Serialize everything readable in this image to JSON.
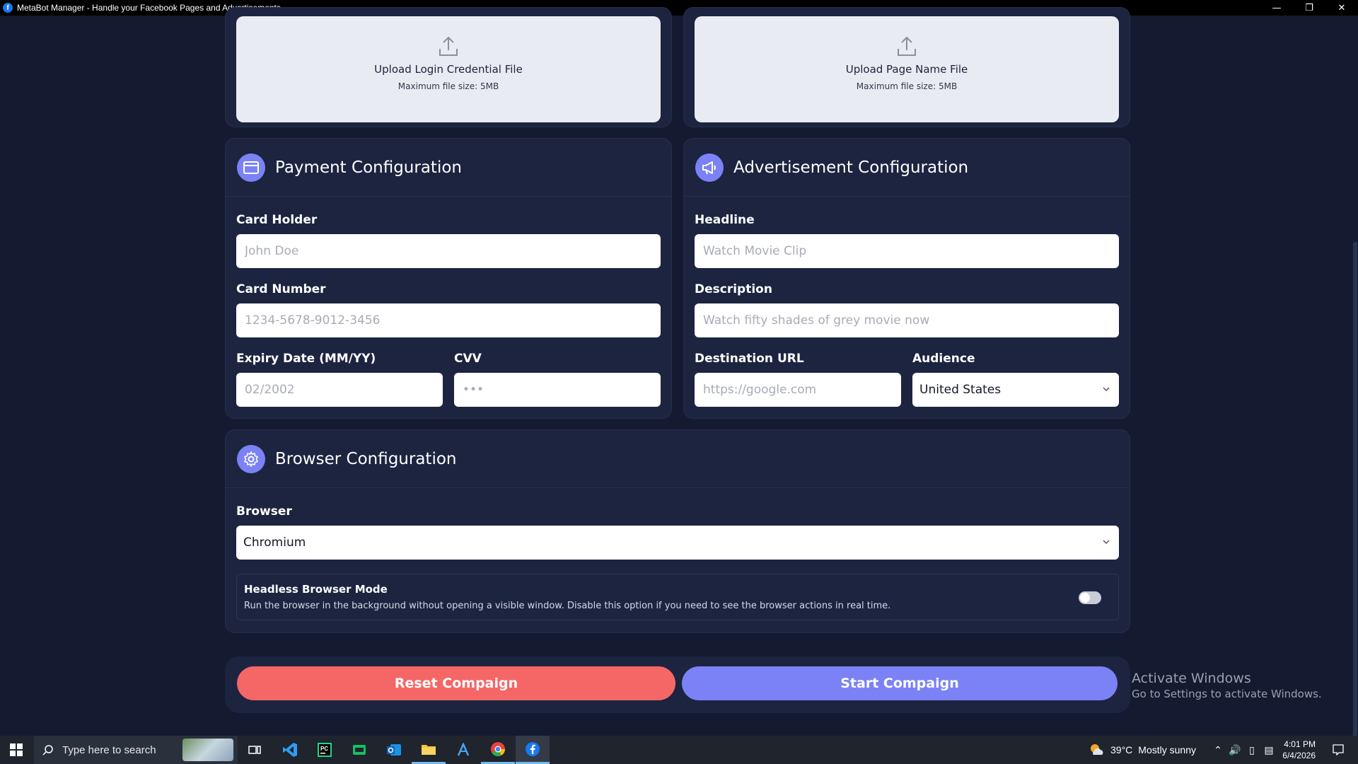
{
  "window": {
    "title": "MetaBot Manager - Handle your Facebook Pages and Advertisements.",
    "logo_letter": "f",
    "controls": {
      "minimize": "—",
      "maximize": "❐",
      "close": "✕"
    }
  },
  "uploads": {
    "credential": {
      "label": "Upload Login Credential File",
      "sub": "Maximum file size: 5MB"
    },
    "page_name": {
      "label": "Upload Page Name File",
      "sub": "Maximum file size: 5MB"
    }
  },
  "payment": {
    "title": "Payment Configuration",
    "card_holder": {
      "label": "Card Holder",
      "placeholder": "John Doe"
    },
    "card_number": {
      "label": "Card Number",
      "placeholder": "1234-5678-9012-3456"
    },
    "expiry": {
      "label": "Expiry Date (MM/YY)",
      "placeholder": "02/2002"
    },
    "cvv": {
      "label": "CVV",
      "placeholder": "•••"
    }
  },
  "advertisement": {
    "title": "Advertisement Configuration",
    "headline": {
      "label": "Headline",
      "placeholder": "Watch Movie Clip"
    },
    "description": {
      "label": "Description",
      "placeholder": "Watch fifty shades of grey movie now"
    },
    "destination": {
      "label": "Destination URL",
      "placeholder": "https://google.com"
    },
    "audience": {
      "label": "Audience",
      "value": "United States"
    }
  },
  "browser": {
    "title": "Browser Configuration",
    "browser_select": {
      "label": "Browser",
      "value": "Chromium"
    },
    "headless": {
      "title": "Headless Browser Mode",
      "description": "Run the browser in the background without opening a visible window. Disable this option if you need to see the browser actions in real time.",
      "enabled": false
    }
  },
  "actions": {
    "reset": "Reset Compaign",
    "start": "Start Compaign"
  },
  "watermark": {
    "line1": "Activate Windows",
    "line2": "Go to Settings to activate Windows."
  },
  "taskbar": {
    "search_placeholder": "Type here to search",
    "apps": [
      "task-view",
      "vs-code",
      "pycharm",
      "terminal",
      "outlook",
      "file-explorer",
      "arc-app",
      "chrome",
      "facebook-app"
    ],
    "weather": {
      "temp": "39°C",
      "condition": "Mostly sunny"
    },
    "clock": {
      "time": "4:01 PM",
      "date": "6/4/2026"
    }
  },
  "colors": {
    "background": "#141b30",
    "card": "#1c2440",
    "accent": "#7b82f5",
    "danger": "#f56767"
  }
}
